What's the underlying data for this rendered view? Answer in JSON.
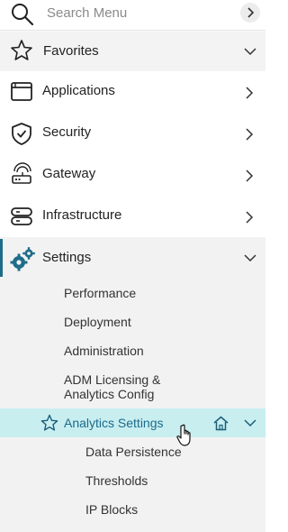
{
  "search": {
    "placeholder": "Search Menu"
  },
  "favorites": {
    "label": "Favorites"
  },
  "nav": [
    {
      "label": "Applications",
      "icon": "window-icon"
    },
    {
      "label": "Security",
      "icon": "shield-icon"
    },
    {
      "label": "Gateway",
      "icon": "gateway-icon"
    },
    {
      "label": "Infrastructure",
      "icon": "server-icon"
    }
  ],
  "settings": {
    "label": "Settings",
    "items": [
      "Performance",
      "Deployment",
      "Administration",
      "ADM Licensing &",
      "Analytics Config"
    ],
    "active": {
      "label": "Analytics Settings",
      "children": [
        "Data Persistence",
        "Thresholds",
        "IP Blocks"
      ]
    }
  },
  "colors": {
    "accent": "#1f6c8a",
    "selected_bg": "#c8eef0",
    "selected_text": "#1a6b8c"
  }
}
